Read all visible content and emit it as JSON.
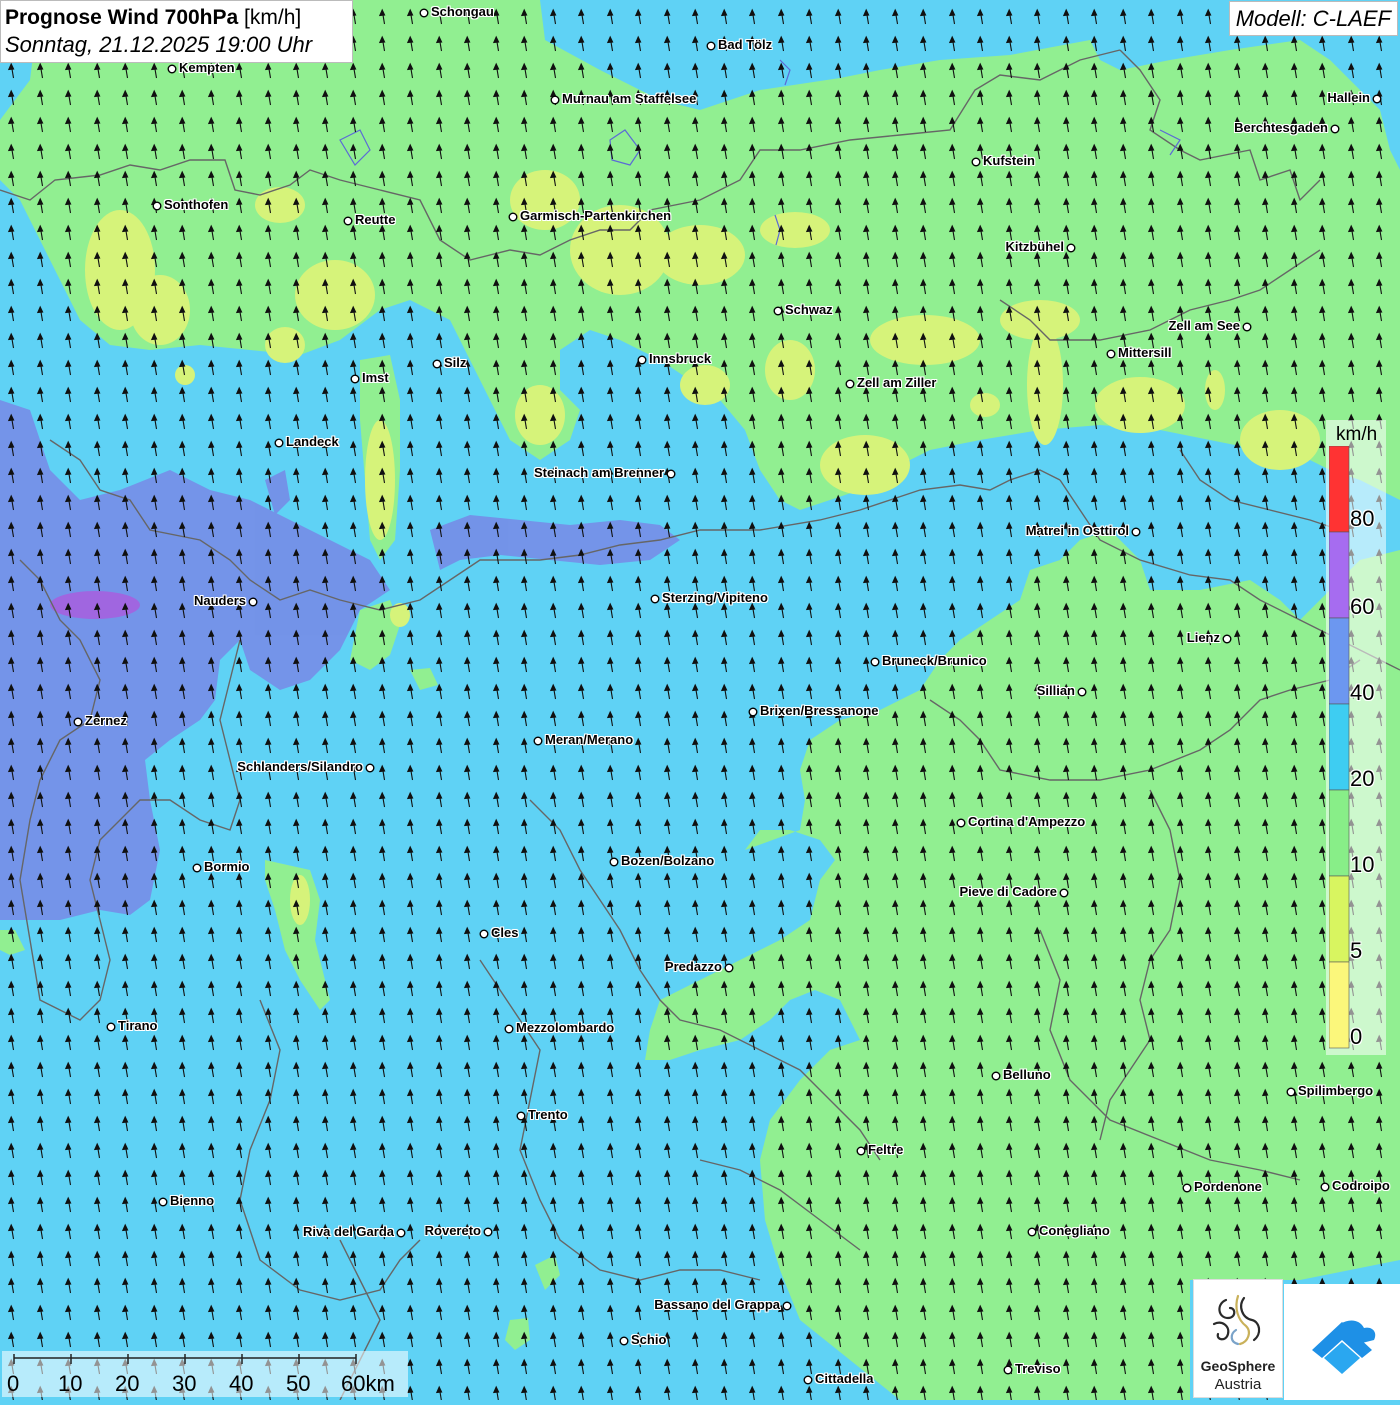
{
  "title": {
    "bold_part": "Prognose Wind 700hPa",
    "unit_part": "[km/h]",
    "subtitle": "Sonntag, 21.12.2025 19:00 Uhr"
  },
  "model_label": "Modell: C-LAEF",
  "legend": {
    "unit": "km/h",
    "ticks": [
      "80",
      "60",
      "40",
      "20",
      "10",
      "5",
      "0"
    ],
    "colors": [
      "#ff3333",
      "#a66cf0",
      "#6c97f0",
      "#3ecdf2",
      "#88ee88",
      "#d8f560",
      "#fbf77b"
    ]
  },
  "colors": {
    "wind_0_5": "#f5ee70",
    "wind_5_10": "#c9ef70",
    "wind_10_20": "#91ef91",
    "wind_20_40": "#5fd2f5",
    "wind_40_60": "#7590e8",
    "wind_60_80": "#a066e0",
    "arrow": "#111111",
    "borders": "#666666"
  },
  "arrow_direction": "north-northwest",
  "cities": [
    "Schongau",
    "Bad Tölz",
    "Kempten",
    "Murnau am Staffelsee",
    "Hallein",
    "Berchtesgaden",
    "Kufstein",
    "Sonthofen",
    "Reutte",
    "Garmisch-Partenkirchen",
    "Kitzbühel",
    "Schwaz",
    "Zell am See",
    "Mittersill",
    "Innsbruck",
    "Silz",
    "Imst",
    "Zell am Ziller",
    "Landeck",
    "Steinach am Brenner",
    "Matrei in Osttirol",
    "Nauders",
    "Sterzing/Vipiteno",
    "Lienz",
    "Bruneck/Brunico",
    "Sillian",
    "Brixen/Bressanone",
    "Zernez",
    "Meran/Merano",
    "Schlanders/Silandro",
    "Cortina d'Ampezzo",
    "Bozen/Bolzano",
    "Bormio",
    "Pieve di Cadore",
    "Cles",
    "Predazzo",
    "Tirano",
    "Mezzolombardo",
    "Belluno",
    "Spilimbergo",
    "Trento",
    "Feltre",
    "Pordenone",
    "Codroipo",
    "Bienno",
    "Riva del Garda",
    "Rovereto",
    "Conegliano",
    "Bassano del Grappa",
    "Schio",
    "Treviso",
    "Cittadella"
  ],
  "scale": {
    "labels": [
      "0",
      "10",
      "20",
      "30",
      "40",
      "50",
      "60km"
    ]
  },
  "logos": {
    "geosphere_line1": "GeoSphere",
    "geosphere_line2": "Austria",
    "blue_logo": "cloud-logo-icon"
  }
}
